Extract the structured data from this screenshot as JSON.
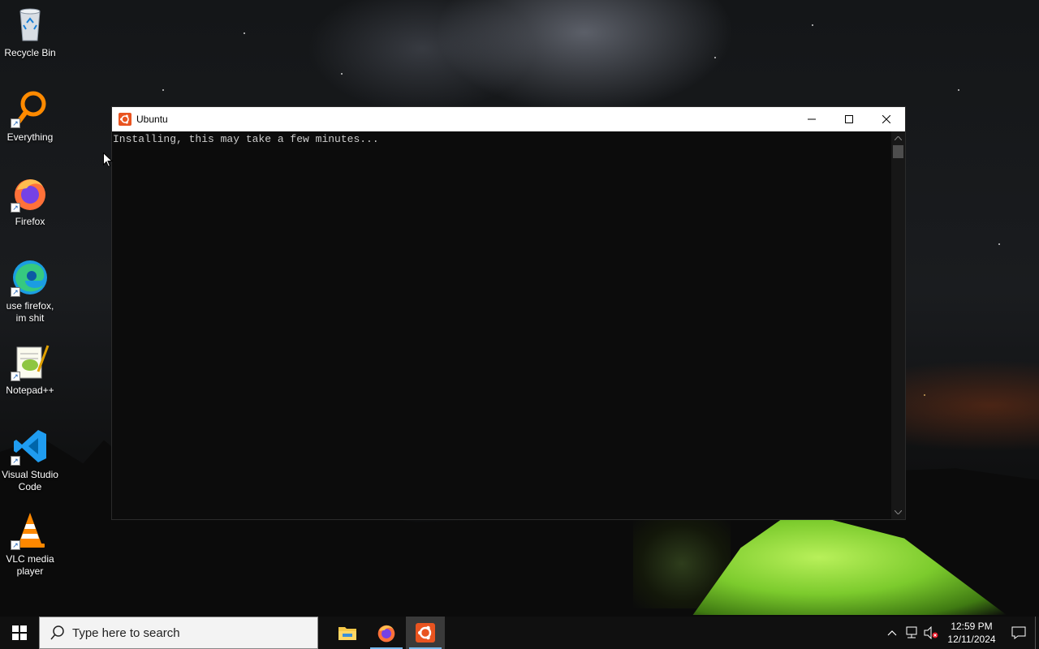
{
  "desktop": {
    "icons": [
      {
        "label": "Recycle Bin",
        "icon": "recycle-bin-icon"
      },
      {
        "label": "Everything",
        "icon": "everything-search-icon"
      },
      {
        "label": "Firefox",
        "icon": "firefox-icon"
      },
      {
        "label": "use firefox, im shit",
        "icon": "edge-icon"
      },
      {
        "label": "Notepad++",
        "icon": "notepad-plus-plus-icon"
      },
      {
        "label": "Visual Studio Code",
        "icon": "vscode-icon"
      },
      {
        "label": "VLC media player",
        "icon": "vlc-icon"
      }
    ]
  },
  "window": {
    "title": "Ubuntu",
    "console_text": "Installing, this may take a few minutes..."
  },
  "taskbar": {
    "search_placeholder": "Type here to search",
    "apps": [
      "file-explorer-icon",
      "firefox-icon",
      "ubuntu-icon"
    ],
    "active_app": "ubuntu-icon",
    "time": "12:59 PM",
    "date": "12/11/2024"
  },
  "colors": {
    "console_bg": "#0c0c0c",
    "console_text": "#cccccc",
    "ubuntu_orange": "#e95420",
    "taskbar_bg": "#101010",
    "active_indicator": "#76b9ed"
  }
}
